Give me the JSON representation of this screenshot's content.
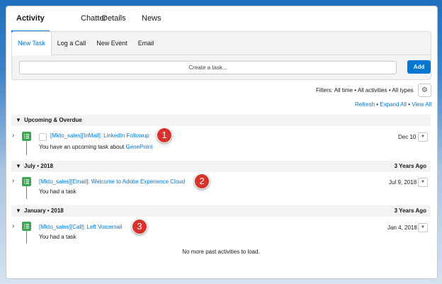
{
  "tabs": [
    "Activity",
    "Chatter",
    "Details",
    "News"
  ],
  "composer": {
    "tabs": [
      "New Task",
      "Log a Call",
      "New Event",
      "Email"
    ],
    "input_placeholder": "Create a task...",
    "add_label": "Add"
  },
  "filters_text": "Filters: All time • All activities • All types",
  "actions": {
    "refresh": "Refresh",
    "sep": " • ",
    "expand": "Expand All",
    "view": "View All"
  },
  "sections": [
    {
      "title": "Upcoming & Overdue",
      "right": ""
    },
    {
      "title": "July • 2018",
      "right": "3 Years Ago"
    },
    {
      "title": "January • 2018",
      "right": "3 Years Ago"
    }
  ],
  "activities": [
    {
      "subject": "[Mkto_sales][InMail]: LinkedIn Followup",
      "desc_prefix": "You have an upcoming task about",
      "desc_link": "GenePoint",
      "date": "Dec 10",
      "badge": "1"
    },
    {
      "subject": "[Mkto_sales][Email]: Welcome to Adobe Experience Cloud",
      "desc_prefix": "You had a task",
      "desc_link": "",
      "date": "Jul 9, 2018",
      "badge": "2"
    },
    {
      "subject": "[Mkto_sales][Call]: Left Voicemail",
      "desc_prefix": "You had a task",
      "desc_link": "",
      "date": "Jan 4, 2018",
      "badge": "3"
    }
  ],
  "no_more": "No more past activities to load.",
  "icons": {
    "task": "task-list-icon",
    "gear": "gear-icon",
    "chevron": "chevron-icon",
    "menu": "dropdown-icon"
  },
  "colors": {
    "accent": "#0176d3",
    "task_green": "#3ba755",
    "badge_red": "#d9312b"
  }
}
